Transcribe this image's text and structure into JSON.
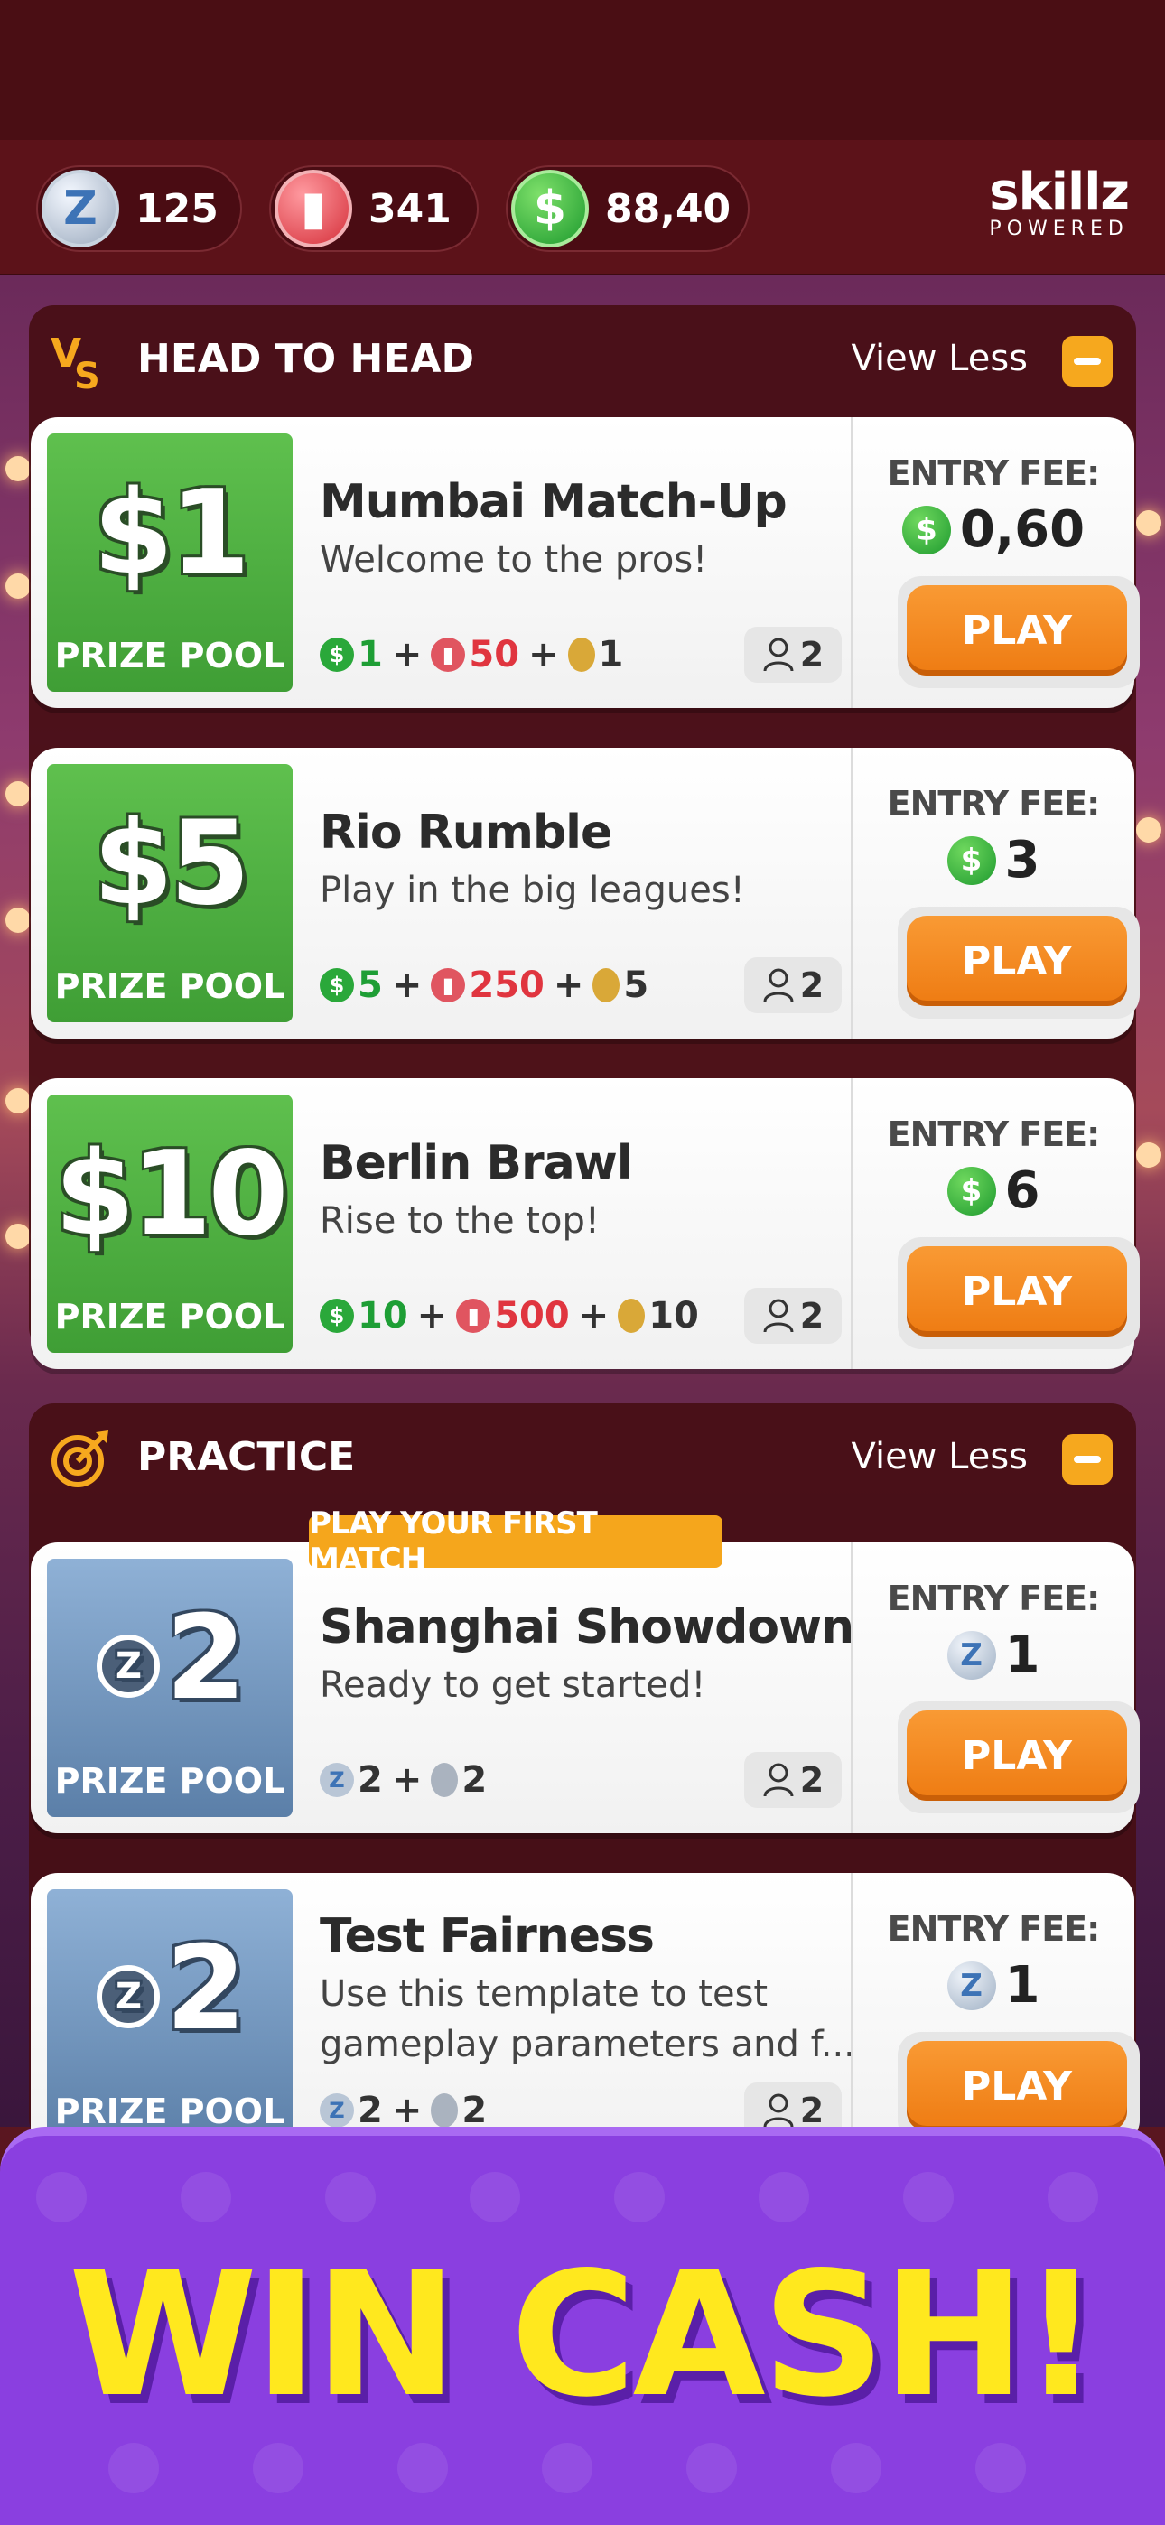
{
  "topbar": {
    "z_coins": "125",
    "tickets": "341",
    "cash": "88,40",
    "brand_top": "skillz",
    "brand_bottom": "POWERED"
  },
  "head_to_head": {
    "title": "HEAD TO HEAD",
    "view_less": "View Less",
    "cards": [
      {
        "prize": "$1",
        "prize_label": "PRIZE POOL",
        "name": "Mumbai Match-Up",
        "tagline": "Welcome to the pros!",
        "r_cash": "1",
        "r_tickets": "50",
        "r_medal": "1",
        "players": "2",
        "entry_label": "ENTRY FEE:",
        "entry": "0,60",
        "play": "PLAY"
      },
      {
        "prize": "$5",
        "prize_label": "PRIZE POOL",
        "name": "Rio Rumble",
        "tagline": "Play in the big leagues!",
        "r_cash": "5",
        "r_tickets": "250",
        "r_medal": "5",
        "players": "2",
        "entry_label": "ENTRY FEE:",
        "entry": "3",
        "play": "PLAY"
      },
      {
        "prize": "$10",
        "prize_label": "PRIZE POOL",
        "name": "Berlin Brawl",
        "tagline": "Rise to the top!",
        "r_cash": "10",
        "r_tickets": "500",
        "r_medal": "10",
        "players": "2",
        "entry_label": "ENTRY FEE:",
        "entry": "6",
        "play": "PLAY"
      }
    ]
  },
  "practice": {
    "title": "PRACTICE",
    "view_less": "View Less",
    "first_match_badge": "PLAY YOUR FIRST MATCH",
    "cards": [
      {
        "prize": "2",
        "prize_label": "PRIZE POOL",
        "name": "Shanghai Showdown",
        "tagline": "Ready to get started!",
        "r_z": "2",
        "r_medal": "2",
        "players": "2",
        "entry_label": "ENTRY FEE:",
        "entry": "1",
        "play": "PLAY"
      },
      {
        "prize": "2",
        "prize_label": "PRIZE POOL",
        "name": "Test Fairness",
        "tagline": "Use this template to test gameplay parameters and f...",
        "r_z": "2",
        "r_medal": "2",
        "players": "2",
        "entry_label": "ENTRY FEE:",
        "entry": "1",
        "play": "PLAY"
      }
    ]
  },
  "banner": {
    "text": "WIN CASH!"
  },
  "colors": {
    "accent_orange": "#ee7b12",
    "cash_green": "#3f9e35",
    "banner_purple": "#8a3fe0",
    "banner_text": "#ffe81e"
  },
  "icons": {
    "z_coin": "z-coin-icon",
    "ticket": "ticket-icon",
    "cash": "dollar-coin-icon",
    "vs": "vs-icon",
    "target": "target-icon",
    "medal": "medal-icon",
    "players": "person-icon"
  }
}
